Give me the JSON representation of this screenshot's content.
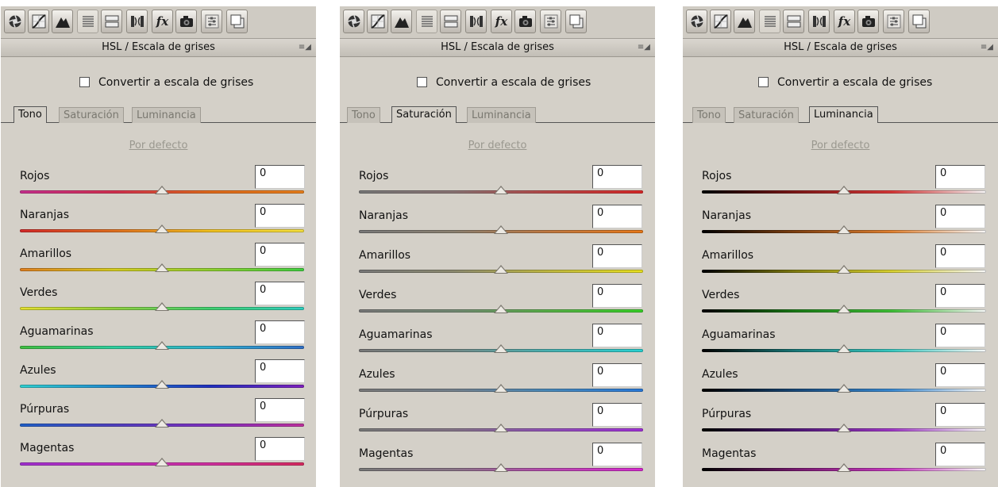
{
  "panels": [
    {
      "title": "HSL / Escala de grises",
      "convert_label": "Convertir a escala de grises",
      "tabs": [
        "Tono",
        "Saturación",
        "Luminancia"
      ],
      "active_tab": 0,
      "default_link": "Por defecto",
      "rows": [
        {
          "label": "Rojos",
          "value": "0",
          "gradient": [
            "#c83090",
            "#d43050",
            "#e06a1c",
            "#e8801c"
          ]
        },
        {
          "label": "Naranjas",
          "value": "0",
          "gradient": [
            "#d42a2a",
            "#e07020",
            "#f0c020",
            "#f4e040"
          ]
        },
        {
          "label": "Amarillos",
          "value": "0",
          "gradient": [
            "#e08020",
            "#d4cc20",
            "#90d030",
            "#40d040"
          ]
        },
        {
          "label": "Verdes",
          "value": "0",
          "gradient": [
            "#e4e030",
            "#90d040",
            "#40d070",
            "#30d0c0"
          ]
        },
        {
          "label": "Aguamarinas",
          "value": "0",
          "gradient": [
            "#40c040",
            "#30d0a0",
            "#30b0d0",
            "#3070c8"
          ]
        },
        {
          "label": "Azules",
          "value": "0",
          "gradient": [
            "#30d0d0",
            "#2088d0",
            "#2030c0",
            "#8020c0"
          ]
        },
        {
          "label": "Púrpuras",
          "value": "0",
          "gradient": [
            "#2060c8",
            "#5040c0",
            "#8030c0",
            "#c030a0"
          ]
        },
        {
          "label": "Magentas",
          "value": "0",
          "gradient": [
            "#a030d0",
            "#c030c0",
            "#d030a0",
            "#d82a60"
          ]
        }
      ]
    },
    {
      "title": "HSL / Escala de grises",
      "convert_label": "Convertir a escala de grises",
      "tabs": [
        "Tono",
        "Saturación",
        "Luminancia"
      ],
      "active_tab": 1,
      "default_link": "Por defecto",
      "rows": [
        {
          "label": "Rojos",
          "value": "0",
          "gradient": [
            "#787878",
            "#8a7474",
            "#b84848",
            "#d82828"
          ]
        },
        {
          "label": "Naranjas",
          "value": "0",
          "gradient": [
            "#787878",
            "#8a8070",
            "#c07840",
            "#e87818"
          ]
        },
        {
          "label": "Amarillos",
          "value": "0",
          "gradient": [
            "#787878",
            "#8c8a70",
            "#c0b840",
            "#e8e020"
          ]
        },
        {
          "label": "Verdes",
          "value": "0",
          "gradient": [
            "#787878",
            "#748a74",
            "#58b048",
            "#38d028"
          ]
        },
        {
          "label": "Aguamarinas",
          "value": "0",
          "gradient": [
            "#787878",
            "#748a88",
            "#48b0b0",
            "#28d0d0"
          ]
        },
        {
          "label": "Azules",
          "value": "0",
          "gradient": [
            "#787878",
            "#74808c",
            "#4888b8",
            "#2878d8"
          ]
        },
        {
          "label": "Púrpuras",
          "value": "0",
          "gradient": [
            "#787878",
            "#847488",
            "#9050b8",
            "#a030d8"
          ]
        },
        {
          "label": "Magentas",
          "value": "0",
          "gradient": [
            "#787878",
            "#8a7488",
            "#b848b0",
            "#d828d0"
          ]
        }
      ]
    },
    {
      "title": "HSL / Escala de grises",
      "convert_label": "Convertir a escala de grises",
      "tabs": [
        "Tono",
        "Saturación",
        "Luminancia"
      ],
      "active_tab": 2,
      "default_link": "Por defecto",
      "rows": [
        {
          "label": "Rojos",
          "value": "0",
          "gradient": [
            "#000000",
            "#801818",
            "#d83838",
            "#f8f8f8"
          ]
        },
        {
          "label": "Naranjas",
          "value": "0",
          "gradient": [
            "#000000",
            "#804010",
            "#e08030",
            "#f8f8f8"
          ]
        },
        {
          "label": "Amarillos",
          "value": "0",
          "gradient": [
            "#000000",
            "#807c10",
            "#d8d030",
            "#f8f8f8"
          ]
        },
        {
          "label": "Verdes",
          "value": "0",
          "gradient": [
            "#000000",
            "#1c7c18",
            "#40c038",
            "#f8f8f8"
          ]
        },
        {
          "label": "Aguamarinas",
          "value": "0",
          "gradient": [
            "#000000",
            "#187878",
            "#38c8c0",
            "#f8f8f8"
          ]
        },
        {
          "label": "Azules",
          "value": "0",
          "gradient": [
            "#000000",
            "#184878",
            "#3888d0",
            "#f8f8f8"
          ]
        },
        {
          "label": "Púrpuras",
          "value": "0",
          "gradient": [
            "#000000",
            "#501878",
            "#a038c8",
            "#f8f8f8"
          ]
        },
        {
          "label": "Magentas",
          "value": "0",
          "gradient": [
            "#000000",
            "#781870",
            "#c838c0",
            "#f8f8f8"
          ]
        }
      ]
    }
  ],
  "toolbar_icons": [
    "basic-adjustments-icon",
    "tone-curve-icon",
    "detail-icon",
    "hsl-grayscale-icon",
    "split-toning-icon",
    "lens-corrections-icon",
    "effects-fx-icon",
    "camera-calibration-icon",
    "presets-icon",
    "snapshots-icon"
  ],
  "fx_label": "fx",
  "panel_menu_glyph": "≡◢",
  "slider_position": 0.5
}
